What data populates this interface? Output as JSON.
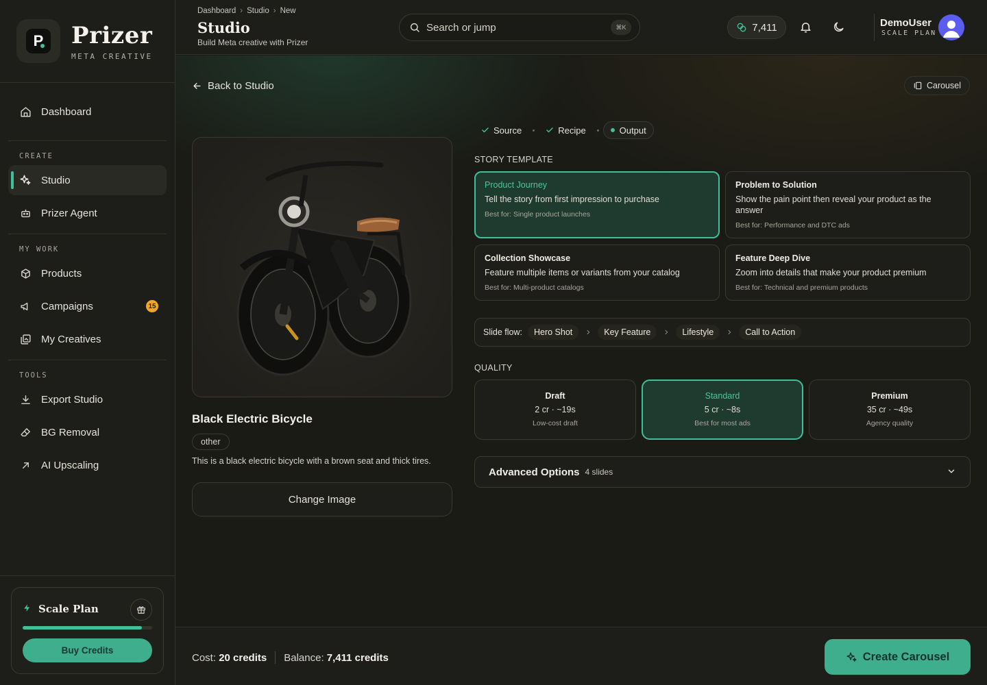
{
  "brand": {
    "name": "Prizer",
    "subtitle": "META CREATIVE",
    "logo_letter": "P"
  },
  "sidebar": {
    "items": [
      {
        "label": "Dashboard",
        "icon": "home-icon"
      },
      {
        "label": "Studio",
        "icon": "sparkles-icon",
        "active": true
      },
      {
        "label": "Prizer Agent",
        "icon": "robot-icon"
      },
      {
        "label": "Products",
        "icon": "box-icon"
      },
      {
        "label": "Campaigns",
        "icon": "megaphone-icon",
        "badge": "15"
      },
      {
        "label": "My Creatives",
        "icon": "gallery-icon"
      },
      {
        "label": "Export Studio",
        "icon": "download-icon"
      },
      {
        "label": "BG Removal",
        "icon": "eraser-icon"
      },
      {
        "label": "AI Upscaling",
        "icon": "arrow-up-right-icon"
      }
    ],
    "sections": {
      "create": "CREATE",
      "my_work": "MY WORK",
      "tools": "TOOLS"
    },
    "plan": {
      "title": "Scale Plan",
      "progress": 0.92,
      "buy_label": "Buy Credits"
    }
  },
  "header": {
    "breadcrumbs": [
      "Dashboard",
      "Studio",
      "New"
    ],
    "title": "Studio",
    "subtitle": "Build Meta creative with Prizer",
    "search_placeholder": "Search or jump",
    "search_shortcut": "⌘K",
    "credits": "7,411",
    "user_name": "DemoUser",
    "user_plan": "SCALE PLAN"
  },
  "main": {
    "back_label": "Back to Studio",
    "format_chip": "Carousel",
    "product": {
      "title": "Black Electric Bicycle",
      "category": "other",
      "description": "This is a black electric bicycle with a brown seat and thick tires.",
      "change_label": "Change Image"
    },
    "steps": [
      {
        "label": "Source",
        "state": "done"
      },
      {
        "label": "Recipe",
        "state": "done"
      },
      {
        "label": "Output",
        "state": "current"
      }
    ],
    "story_label": "STORY TEMPLATE",
    "templates": [
      {
        "title": "Product Journey",
        "desc": "Tell the story from first impression to purchase",
        "best": "Best for: Single product launches",
        "selected": true
      },
      {
        "title": "Problem to Solution",
        "desc": "Show the pain point then reveal your product as the answer",
        "best": "Best for: Performance and DTC ads"
      },
      {
        "title": "Collection Showcase",
        "desc": "Feature multiple items or variants from your catalog",
        "best": "Best for: Multi-product catalogs"
      },
      {
        "title": "Feature Deep Dive",
        "desc": "Zoom into details that make your product premium",
        "best": "Best for: Technical and premium products"
      }
    ],
    "slide_flow": {
      "label": "Slide flow:",
      "steps": [
        "Hero Shot",
        "Key Feature",
        "Lifestyle",
        "Call to Action"
      ]
    },
    "quality_label": "QUALITY",
    "quality": [
      {
        "name": "Draft",
        "cost": "2 cr · ~19s",
        "note": "Low-cost draft"
      },
      {
        "name": "Standard",
        "cost": "5 cr · ~8s",
        "note": "Best for most ads",
        "selected": true
      },
      {
        "name": "Premium",
        "cost": "35 cr · ~49s",
        "note": "Agency quality"
      }
    ],
    "advanced": {
      "title": "Advanced Options",
      "count": "4 slides"
    }
  },
  "footer": {
    "cost_label": "Cost:",
    "cost_value": "20 credits",
    "balance_label": "Balance:",
    "balance_value": "7,411 credits",
    "create_label": "Create Carousel"
  },
  "colors": {
    "accent": "#3fbf9a",
    "button": "#3fae8c",
    "badge": "#f5a524",
    "avatar": "#5b5cf0"
  }
}
